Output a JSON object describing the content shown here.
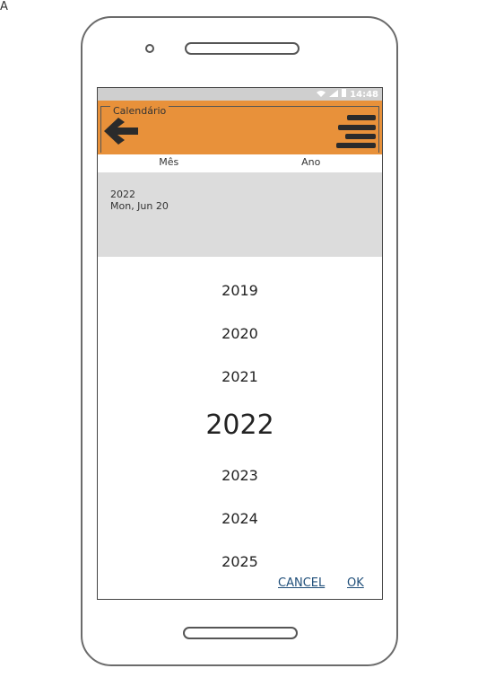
{
  "corner_mark": "A",
  "status_bar": {
    "time": "14:48",
    "wifi_icon": "wifi-icon",
    "signal_icon": "signal-icon",
    "battery_icon": "battery-icon"
  },
  "header": {
    "title": "Calendário",
    "back_icon": "arrow-left-icon",
    "menu_icon": "hamburger-menu-icon",
    "color": "#e8913a"
  },
  "tabs": [
    {
      "label": "Mês"
    },
    {
      "label": "Ano"
    }
  ],
  "date_panel": {
    "year": "2022",
    "full_date": "Mon, Jun 20"
  },
  "year_list": [
    {
      "label": "2019",
      "selected": false
    },
    {
      "label": "2020",
      "selected": false
    },
    {
      "label": "2021",
      "selected": false
    },
    {
      "label": "2022",
      "selected": true
    },
    {
      "label": "2023",
      "selected": false
    },
    {
      "label": "2024",
      "selected": false
    },
    {
      "label": "2025",
      "selected": false
    }
  ],
  "actions": {
    "cancel": "CANCEL",
    "ok": "OK"
  }
}
